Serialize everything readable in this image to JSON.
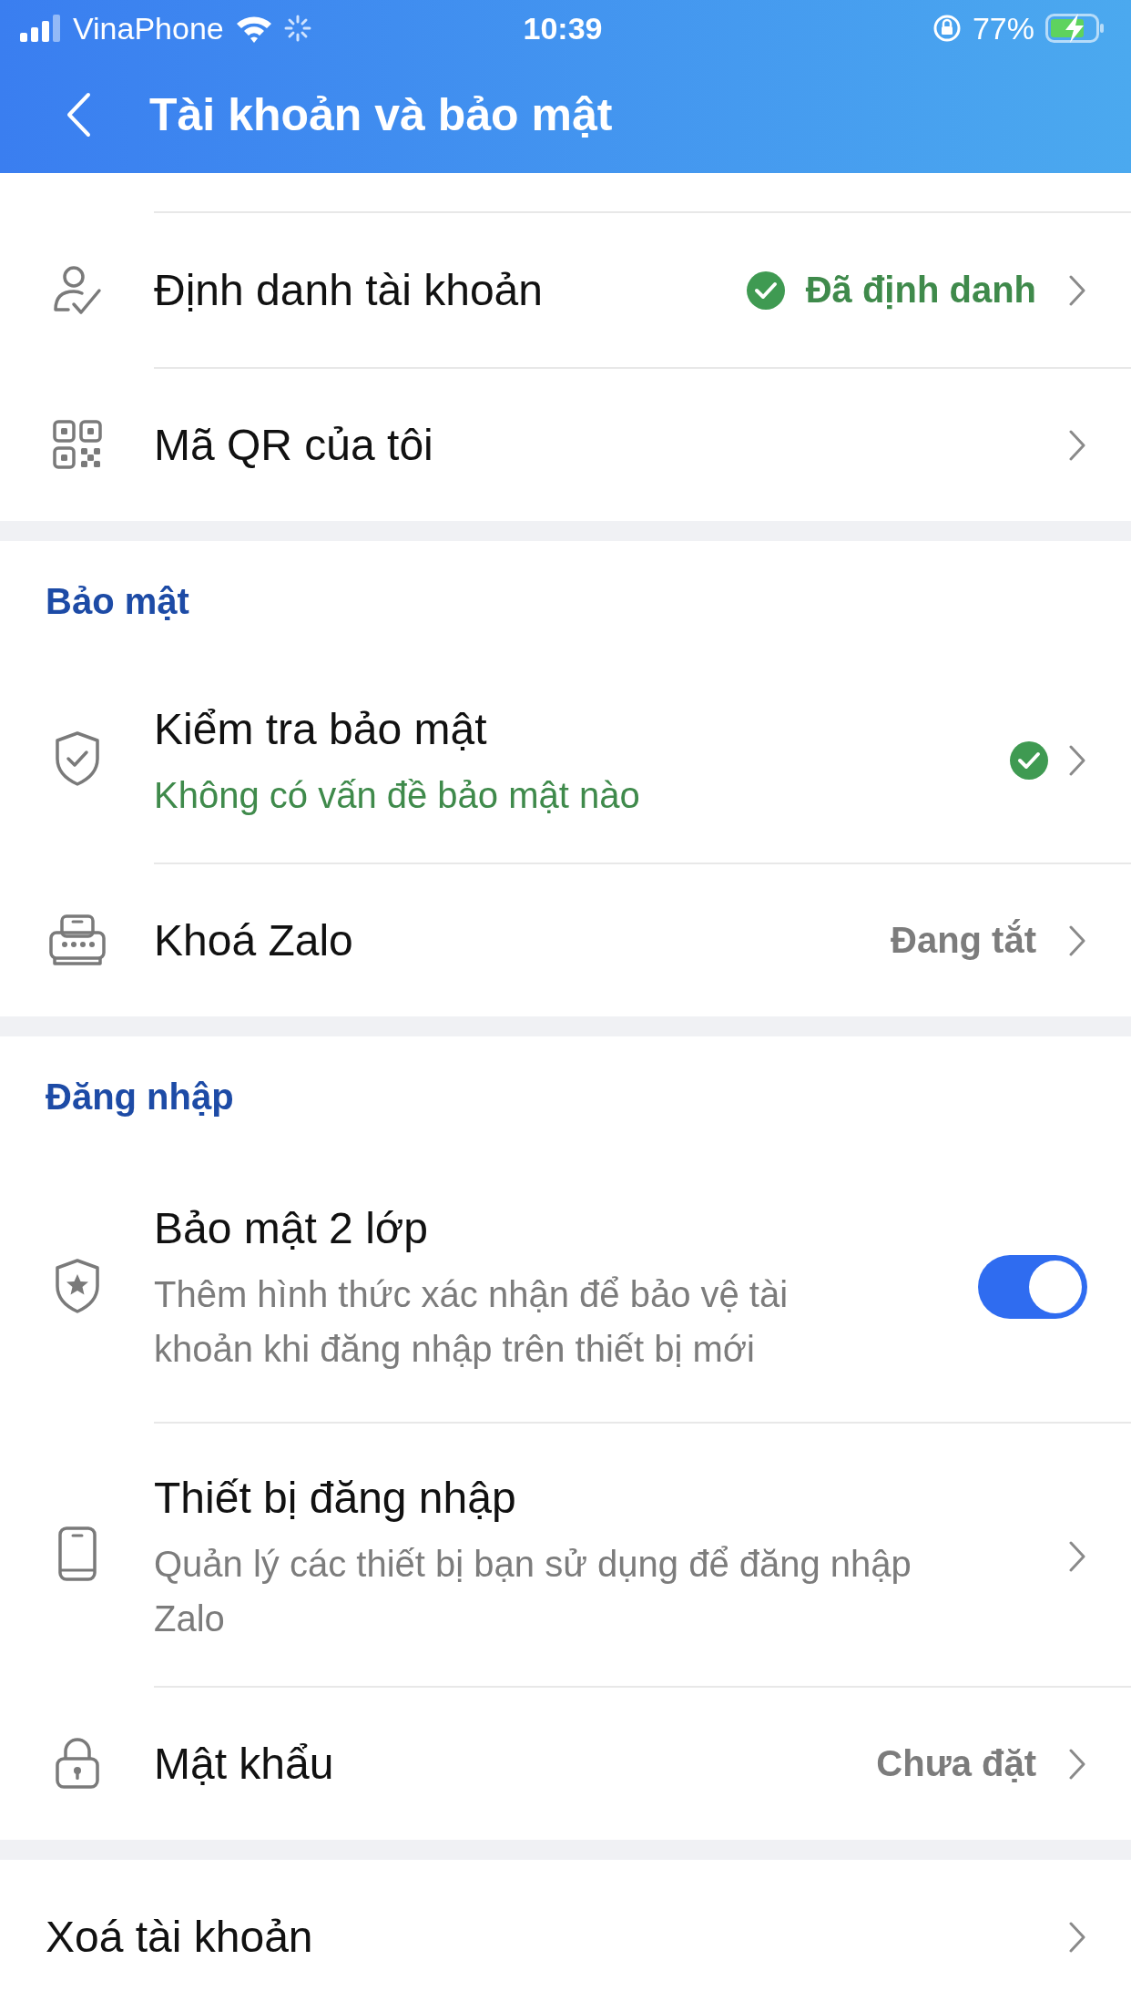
{
  "status_bar": {
    "carrier": "VinaPhone",
    "time": "10:39",
    "battery": "77%"
  },
  "header": {
    "title": "Tài khoản và bảo mật"
  },
  "sections": [
    {
      "rows": [
        {
          "kind": "nav",
          "title": "Định danh tài khoản",
          "value": "Đã định danh",
          "verified": true
        },
        {
          "kind": "nav",
          "title": "Mã QR của tôi",
          "verified": false
        }
      ]
    },
    {
      "header": "Bảo mật",
      "rows": [
        {
          "kind": "nav",
          "title": "Kiểm tra bảo mật",
          "subtitle": "Không có vấn đề bảo mật nào",
          "verified": true
        },
        {
          "kind": "nav",
          "title": "Khoá Zalo",
          "value": "Đang tắt",
          "verified": false
        }
      ]
    },
    {
      "header": "Đăng nhập",
      "rows": [
        {
          "kind": "toggle",
          "title": "Bảo mật 2 lớp",
          "subtitle": "Thêm hình thức xác nhận để bảo vệ tài khoản khi đăng nhập trên thiết bị mới",
          "verified": false,
          "on": true
        },
        {
          "kind": "nav",
          "title": "Thiết bị đăng nhập",
          "subtitle": "Quản lý các thiết bị bạn sử dụng để đăng nhập Zalo",
          "verified": false
        },
        {
          "kind": "nav",
          "title": "Mật khẩu",
          "value": "Chưa đặt",
          "verified": false
        }
      ]
    },
    {
      "rows": [
        {
          "kind": "nav",
          "title": "Xoá tài khoản",
          "verified": false
        }
      ]
    }
  ]
}
